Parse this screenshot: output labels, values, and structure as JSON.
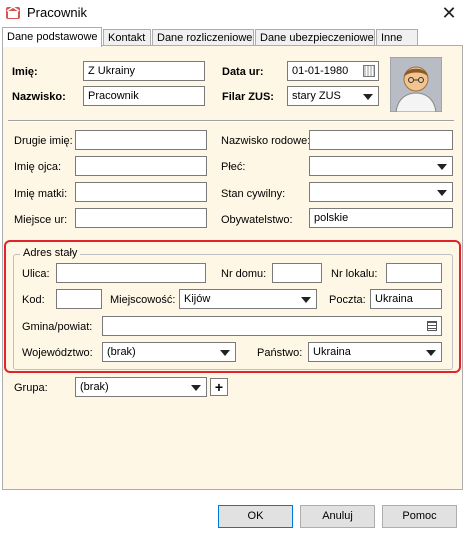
{
  "window": {
    "title": "Pracownik",
    "close_glyph": "✕"
  },
  "tabs": [
    {
      "label": "Dane podstawowe"
    },
    {
      "label": "Kontakt"
    },
    {
      "label": "Dane rozliczeniowe"
    },
    {
      "label": "Dane ubezpieczeniowe"
    },
    {
      "label": "Inne"
    }
  ],
  "basic": {
    "first_name_label": "Imię:",
    "first_name": "Z Ukrainy",
    "last_name_label": "Nazwisko:",
    "last_name": "Pracownik",
    "birth_date_label": "Data ur:",
    "birth_date": "01-01-1980",
    "zus_label": "Filar ZUS:",
    "zus": "stary ZUS"
  },
  "personal": {
    "second_name_label": "Drugie imię:",
    "second_name": "",
    "maiden_name_label": "Nazwisko rodowe:",
    "maiden_name": "",
    "father_label": "Imię ojca:",
    "father": "",
    "sex_label": "Płeć:",
    "sex": "",
    "mother_label": "Imię matki:",
    "mother": "",
    "marital_label": "Stan cywilny:",
    "marital": "",
    "birthplace_label": "Miejsce ur:",
    "birthplace": "",
    "citizenship_label": "Obywatelstwo:",
    "citizenship": "polskie"
  },
  "address": {
    "group_title": "Adres stały",
    "street_label": "Ulica:",
    "street": "",
    "house_label": "Nr domu:",
    "house": "",
    "flat_label": "Nr lokalu:",
    "flat": "",
    "postcode_label": "Kod:",
    "postcode": "",
    "city_label": "Miejscowość:",
    "city": "Kijów",
    "post_label": "Poczta:",
    "post": "Ukraina",
    "commune_label": "Gmina/powiat:",
    "commune": "",
    "voivodeship_label": "Województwo:",
    "voivodeship": "(brak)",
    "country_label": "Państwo:",
    "country": "Ukraina"
  },
  "group": {
    "label": "Grupa:",
    "value": "(brak)",
    "add_glyph": "+"
  },
  "footer": {
    "ok": "OK",
    "cancel": "Anuluj",
    "help": "Pomoc"
  },
  "colors": {
    "panel_bg": "#fff7e6",
    "highlight": "#e0242a"
  }
}
